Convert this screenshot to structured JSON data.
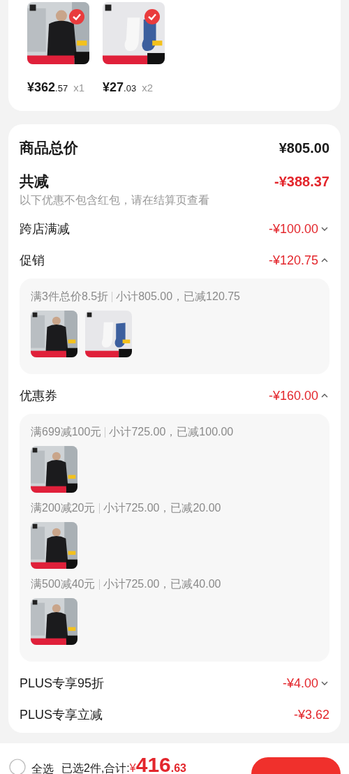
{
  "products": [
    {
      "kind": "picture",
      "checked": true,
      "price_main": "¥362",
      "price_cents": ".57",
      "quantity": "x1"
    },
    {
      "kind": "picture",
      "checked": true,
      "price_main": "¥27",
      "price_cents": ".03",
      "quantity": "x2"
    }
  ],
  "summary": {
    "total_label": "商品总价",
    "total_value": "¥805.00",
    "reduction_label": "共减",
    "reduction_value": "-¥388.37",
    "reduction_note": "以下优惠不包含红包，请在结算页查看"
  },
  "discounts": [
    {
      "label": "跨店满减",
      "amount": "-¥100.00",
      "kind": "collapsible",
      "expanded": false
    },
    {
      "label": "促销",
      "amount": "-¥120.75",
      "kind": "collapsible",
      "expanded": true,
      "groups": [
        {
          "rule": "满3件总价8.5折",
          "detail": "小计805.00，已减120.75"
        }
      ]
    },
    {
      "label": "优惠券",
      "amount": "-¥160.00",
      "kind": "collapsible",
      "expanded": true,
      "groups": [
        {
          "rule": "满699减100元",
          "detail": "小计725.00，已减100.00"
        },
        {
          "rule": "满200减20元",
          "detail": "小计725.00，已减20.00"
        },
        {
          "rule": "满500减40元",
          "detail": "小计725.00，已减40.00"
        }
      ]
    },
    {
      "label": "PLUS专享95折",
      "amount": "-¥4.00",
      "kind": "collapsible",
      "expanded": false
    },
    {
      "label": "PLUS专享立减",
      "amount": "-¥3.62",
      "kind": "plain"
    }
  ],
  "footer": {
    "select_all_label": "全选",
    "select_all_checked": false,
    "selected_text": "已选2件,合计:",
    "total_currency": "¥",
    "total_main": "416",
    "total_cents": ".63"
  }
}
